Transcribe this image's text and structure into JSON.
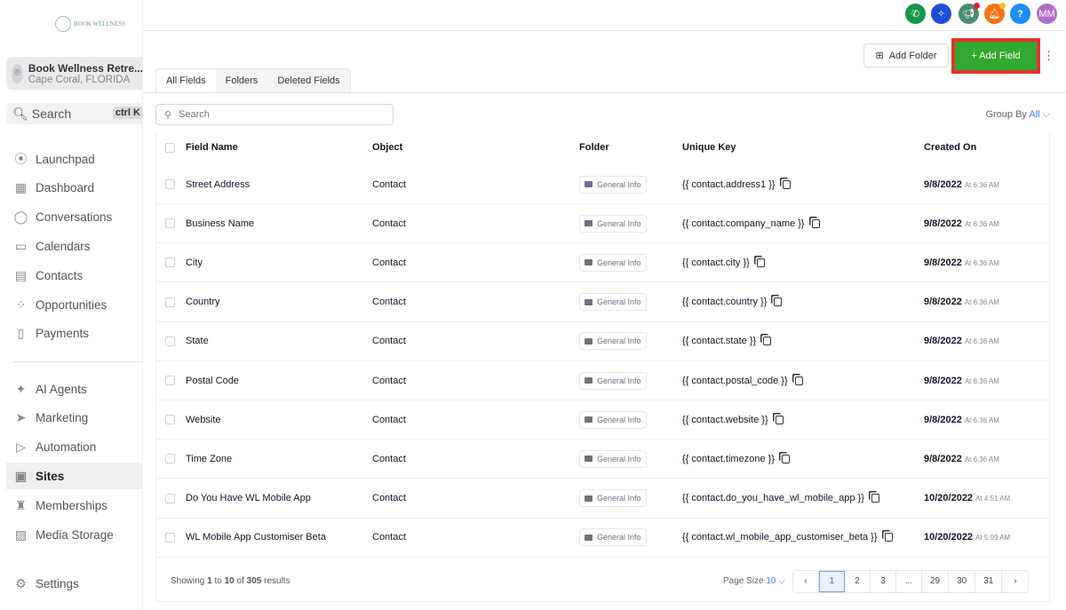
{
  "logo": {
    "text": "BOOK WELLNESS"
  },
  "account": {
    "name": "Book Wellness Retre...",
    "location": "Cape Coral, FLORIDA"
  },
  "sidebar_search": {
    "label": "Search",
    "shortcut": "ctrl K"
  },
  "nav": [
    {
      "label": "Launchpad",
      "icon": "rocket-icon"
    },
    {
      "label": "Dashboard",
      "icon": "grid-icon"
    },
    {
      "label": "Conversations",
      "icon": "chat-icon"
    },
    {
      "label": "Calendars",
      "icon": "calendar-icon"
    },
    {
      "label": "Contacts",
      "icon": "contacts-icon"
    },
    {
      "label": "Opportunities",
      "icon": "pipeline-icon"
    },
    {
      "label": "Payments",
      "icon": "payments-icon"
    },
    {
      "label": "AI Agents",
      "icon": "sparkle-icon"
    },
    {
      "label": "Marketing",
      "icon": "send-icon"
    },
    {
      "label": "Automation",
      "icon": "automation-icon"
    },
    {
      "label": "Sites",
      "icon": "sites-icon"
    },
    {
      "label": "Memberships",
      "icon": "membership-icon"
    },
    {
      "label": "Media Storage",
      "icon": "image-icon"
    },
    {
      "label": "Settings",
      "icon": "gear-icon"
    }
  ],
  "topbar": {
    "avatar": "MM",
    "help": "?"
  },
  "toolbar": {
    "add_folder": "Add Folder",
    "add_field": "+ Add Field"
  },
  "tabs": [
    "All Fields",
    "Folders",
    "Deleted Fields"
  ],
  "search": {
    "placeholder": "Search"
  },
  "group_by": {
    "label": "Group By",
    "value": "All"
  },
  "table": {
    "headers": [
      "Field Name",
      "Object",
      "Folder",
      "Unique Key",
      "Created On"
    ],
    "rows": [
      {
        "name": "Street Address",
        "object": "Contact",
        "folder": "General Info",
        "key": "{{ contact.address1 }}",
        "date": "9/8/2022",
        "time": "At 6:36 AM"
      },
      {
        "name": "Business Name",
        "object": "Contact",
        "folder": "General Info",
        "key": "{{ contact.company_name }}",
        "date": "9/8/2022",
        "time": "At 6:36 AM"
      },
      {
        "name": "City",
        "object": "Contact",
        "folder": "General Info",
        "key": "{{ contact.city }}",
        "date": "9/8/2022",
        "time": "At 6:36 AM"
      },
      {
        "name": "Country",
        "object": "Contact",
        "folder": "General Info",
        "key": "{{ contact.country }}",
        "date": "9/8/2022",
        "time": "At 6:36 AM"
      },
      {
        "name": "State",
        "object": "Contact",
        "folder": "General Info",
        "key": "{{ contact.state }}",
        "date": "9/8/2022",
        "time": "At 6:36 AM"
      },
      {
        "name": "Postal Code",
        "object": "Contact",
        "folder": "General Info",
        "key": "{{ contact.postal_code }}",
        "date": "9/8/2022",
        "time": "At 6:36 AM"
      },
      {
        "name": "Website",
        "object": "Contact",
        "folder": "General Info",
        "key": "{{ contact.website }}",
        "date": "9/8/2022",
        "time": "At 6:36 AM"
      },
      {
        "name": "Time Zone",
        "object": "Contact",
        "folder": "General Info",
        "key": "{{ contact.timezone }}",
        "date": "9/8/2022",
        "time": "At 6:36 AM"
      },
      {
        "name": "Do You Have WL Mobile App",
        "object": "Contact",
        "folder": "General Info",
        "key": "{{ contact.do_you_have_wl_mobile_app }}",
        "date": "10/20/2022",
        "time": "At 4:51 AM"
      },
      {
        "name": "WL Mobile App Customiser Beta",
        "object": "Contact",
        "folder": "General Info",
        "key": "{{ contact.wl_mobile_app_customiser_beta }}",
        "date": "10/20/2022",
        "time": "At 5:09 AM"
      }
    ]
  },
  "footer": {
    "showing": "Showing",
    "from": "1",
    "to_word": "to",
    "to": "10",
    "of_word": "of",
    "total": "305",
    "results": "results",
    "page_size_label": "Page Size",
    "page_size": "10",
    "pages": [
      "1",
      "2",
      "3",
      "...",
      "29",
      "30",
      "31"
    ],
    "current_page": "1"
  }
}
